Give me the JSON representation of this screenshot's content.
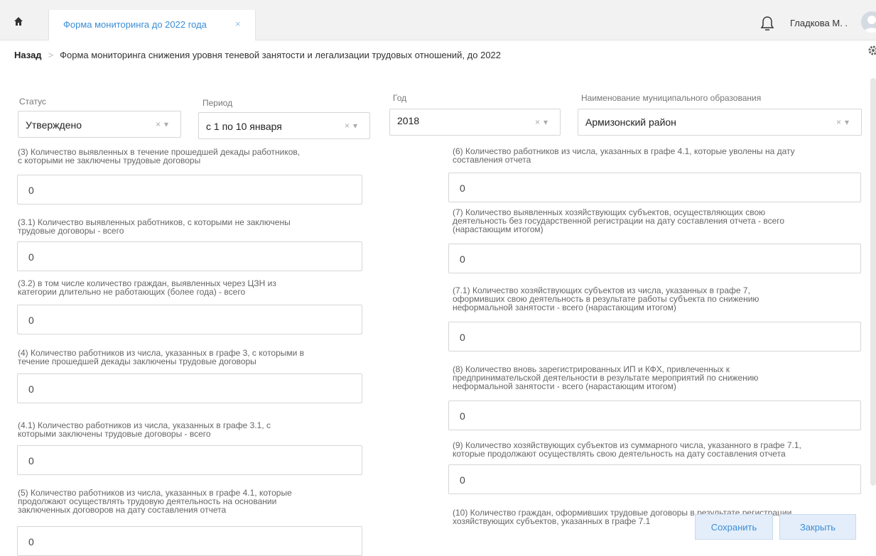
{
  "topbar": {
    "tab_label": "Форма мониторинга до 2022 года",
    "tab_close": "×",
    "user_name": "Гладкова М. ."
  },
  "breadcrumb": {
    "back": "Назад",
    "separator": ">",
    "title": "Форма мониторинга снижения уровня теневой занятости и легализации трудовых отношений, до 2022"
  },
  "filters": {
    "status": {
      "label": "Статус",
      "value": "Утверждено"
    },
    "period": {
      "label": "Период",
      "value": "с 1 по 10 января"
    },
    "year": {
      "label": "Год",
      "value": "2018"
    },
    "municipality": {
      "label": "Наименование муниципального образования",
      "value": "Армизонский район"
    },
    "clear_glyph": "×",
    "arrow_glyph": "▾"
  },
  "left_fields": [
    {
      "label1": "(3) Количество выявленных в течение прошедшей декады работников,",
      "label2": "с которыми не заключены трудовые договоры",
      "label3": "",
      "value": "0"
    },
    {
      "label1": "(3.1) Количество выявленных работников, с которыми не заключены",
      "label2": "трудовые договоры - всего",
      "label3": "",
      "value": "0"
    },
    {
      "label1": "(3.2) в том числе количество граждан, выявленных через ЦЗН из",
      "label2": "категории длительно не работающих (более года) - всего",
      "label3": "",
      "value": "0"
    },
    {
      "label1": "(4) Количество работников из числа, указанных в графе 3, с которыми в",
      "label2": "течение прошедшей декады заключены трудовые договоры",
      "label3": "",
      "value": "0"
    },
    {
      "label1": "(4.1) Количество работников из числа, указанных в графе 3.1, с",
      "label2": "которыми заключены трудовые договоры - всего",
      "label3": "",
      "value": "0"
    },
    {
      "label1": "(5) Количество работников из числа, указанных в графе 4.1, которые",
      "label2": "продолжают осуществлять трудовую деятельность на основании",
      "label3": "заключенных договоров на дату составления отчета",
      "value": "0"
    }
  ],
  "right_fields": [
    {
      "label1": "(6) Количество работников из числа, указанных в графе 4.1, которые уволены на дату",
      "label2": "составления отчета",
      "label3": "",
      "value": "0"
    },
    {
      "label1": "(7) Количество выявленных хозяйствующих субъектов, осуществляющих свою",
      "label2": "деятельность без государственной регистрации на дату составления отчета - всего",
      "label3": "(нарастающим итогом)",
      "value": "0"
    },
    {
      "label1": "(7.1) Количество хозяйствующих субъектов из числа, указанных в графе 7,",
      "label2": "оформивших свою деятельность в результате работы субъекта по снижению",
      "label3": "неформальной занятости - всего (нарастающим итогом)",
      "value": "0"
    },
    {
      "label1": "(8) Количество вновь зарегистрированных ИП и КФХ, привлеченных к",
      "label2": "предпринимательской деятельности в результате мероприятий по снижению",
      "label3": "неформальной занятости - всего (нарастающим итогом)",
      "value": "0"
    },
    {
      "label1": "(9) Количество хозяйствующих субъектов из суммарного числа, указанного в графе 7.1,",
      "label2": "которые продолжают осуществлять свою деятельность на дату составления отчета",
      "label3": "",
      "value": "0"
    },
    {
      "label1": "(10) Количество граждан, оформивших трудовые договоры в результате регистрации",
      "label2": "хозяйствующих субъектов, указанных в графе 7.1",
      "label3": "",
      "value": ""
    }
  ],
  "actions": {
    "save": "Сохранить",
    "close": "Закрыть"
  }
}
